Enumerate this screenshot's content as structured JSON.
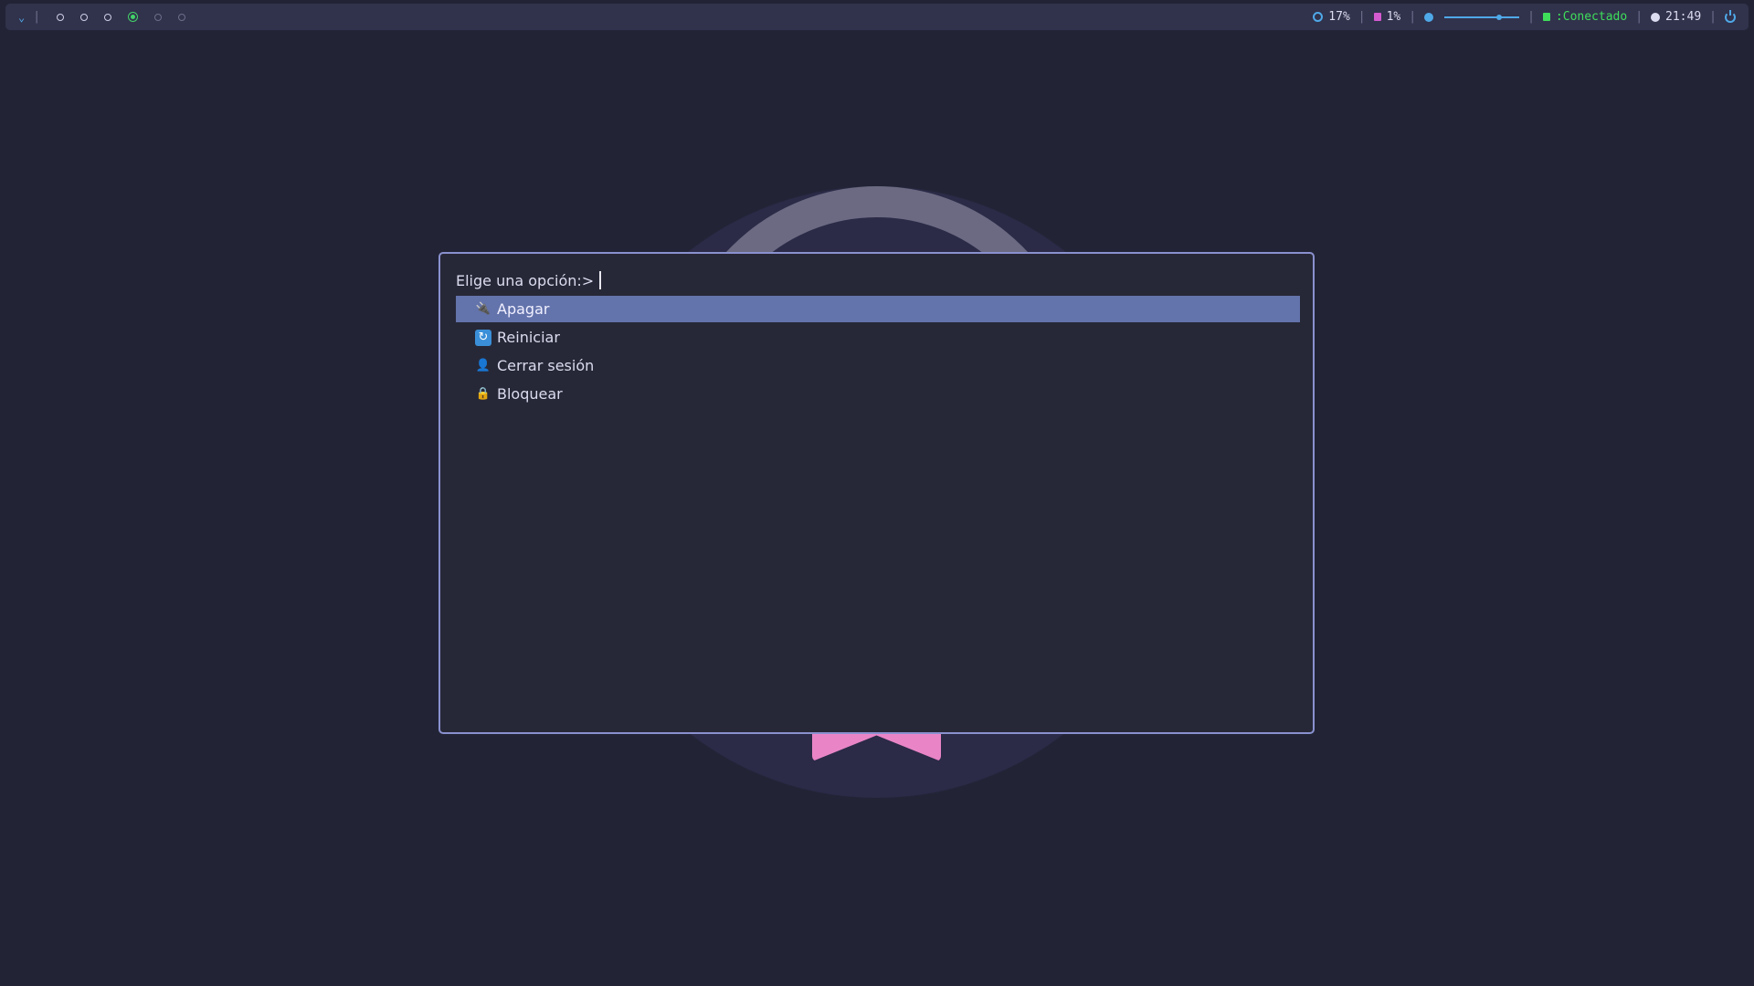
{
  "topbar": {
    "workspaces": [
      "",
      "",
      "",
      "",
      "",
      ""
    ],
    "active_workspace": 4,
    "cpu": "17%",
    "memory": "1%",
    "volume_level": 0.75,
    "network": ":Conectado",
    "clock": "21:49"
  },
  "menu": {
    "prompt": "Elige una opción:>",
    "items": [
      {
        "label": "Apagar",
        "icon": "plug-icon"
      },
      {
        "label": "Reiniciar",
        "icon": "restart-icon"
      },
      {
        "label": "Cerrar sesión",
        "icon": "user-icon"
      },
      {
        "label": "Bloquear",
        "icon": "lock-icon"
      }
    ],
    "selected_index": 0
  },
  "colors": {
    "background": "#222436",
    "bar": "#31324c",
    "selection": "#6373ab",
    "accent_blue": "#4fa9e8",
    "accent_green": "#42d368",
    "accent_pink": "#e985c7"
  }
}
